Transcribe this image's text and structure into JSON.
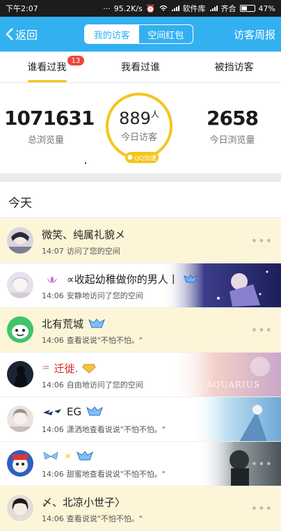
{
  "status_bar": {
    "time": "下午2:07",
    "speed": "95.2K/s",
    "carrier1": "软件库",
    "carrier2": "齐合",
    "battery": "47%",
    "battery_level": 0.47
  },
  "nav": {
    "back_label": "返回",
    "segments": [
      "我的访客",
      "空间红包"
    ],
    "active_segment": 0,
    "right_label": "访客周报"
  },
  "tabs": {
    "items": [
      "谁看过我",
      "我看过谁",
      "被挡访客"
    ],
    "badge": "13",
    "active": 0
  },
  "stats": {
    "total_views": "1071631",
    "total_views_label": "总浏览量",
    "today_visitors": "889",
    "today_visitors_unit": "人",
    "today_visitors_label": "今日访客",
    "qq_badge": "QQ加速",
    "today_views": "2658",
    "today_views_label": "今日浏览量"
  },
  "section_title": "今天",
  "colors": {
    "nav_blue": "#33b0f0",
    "accent_yellow": "#f5c518",
    "badge_red": "#f0443c",
    "row_yellow": "#fdf5d8"
  },
  "visitors": [
    {
      "name": "微笑、纯属礼貌メ",
      "time": "14:07",
      "action": "访问了您的空间",
      "badges": ""
    },
    {
      "name": "∝收起幼稚做你的男人丨",
      "time": "14:06",
      "action": "安静地访问了您的空间",
      "badges": ""
    },
    {
      "name": "北有荒城",
      "time": "14:06",
      "action": "查看说说\"不怕不怕。\"",
      "badges": ""
    },
    {
      "name": "迁徙.",
      "time": "14:06",
      "action": "自由地访问了您的空间",
      "badges": "",
      "deco_text": "AQUARIUS"
    },
    {
      "name": "EG",
      "time": "14:06",
      "action": "潇洒地查看说说\"不怕不怕。\"",
      "badges": ""
    },
    {
      "name": "",
      "time": "14:06",
      "action": "甜蜜地查看说说\"不怕不怕。\"",
      "badges": ""
    },
    {
      "name": "〆、北凉小世子〉",
      "time": "14:06",
      "action": "查看说说\"不怕不怕。\"",
      "badges": ""
    }
  ],
  "more_label": "•••"
}
